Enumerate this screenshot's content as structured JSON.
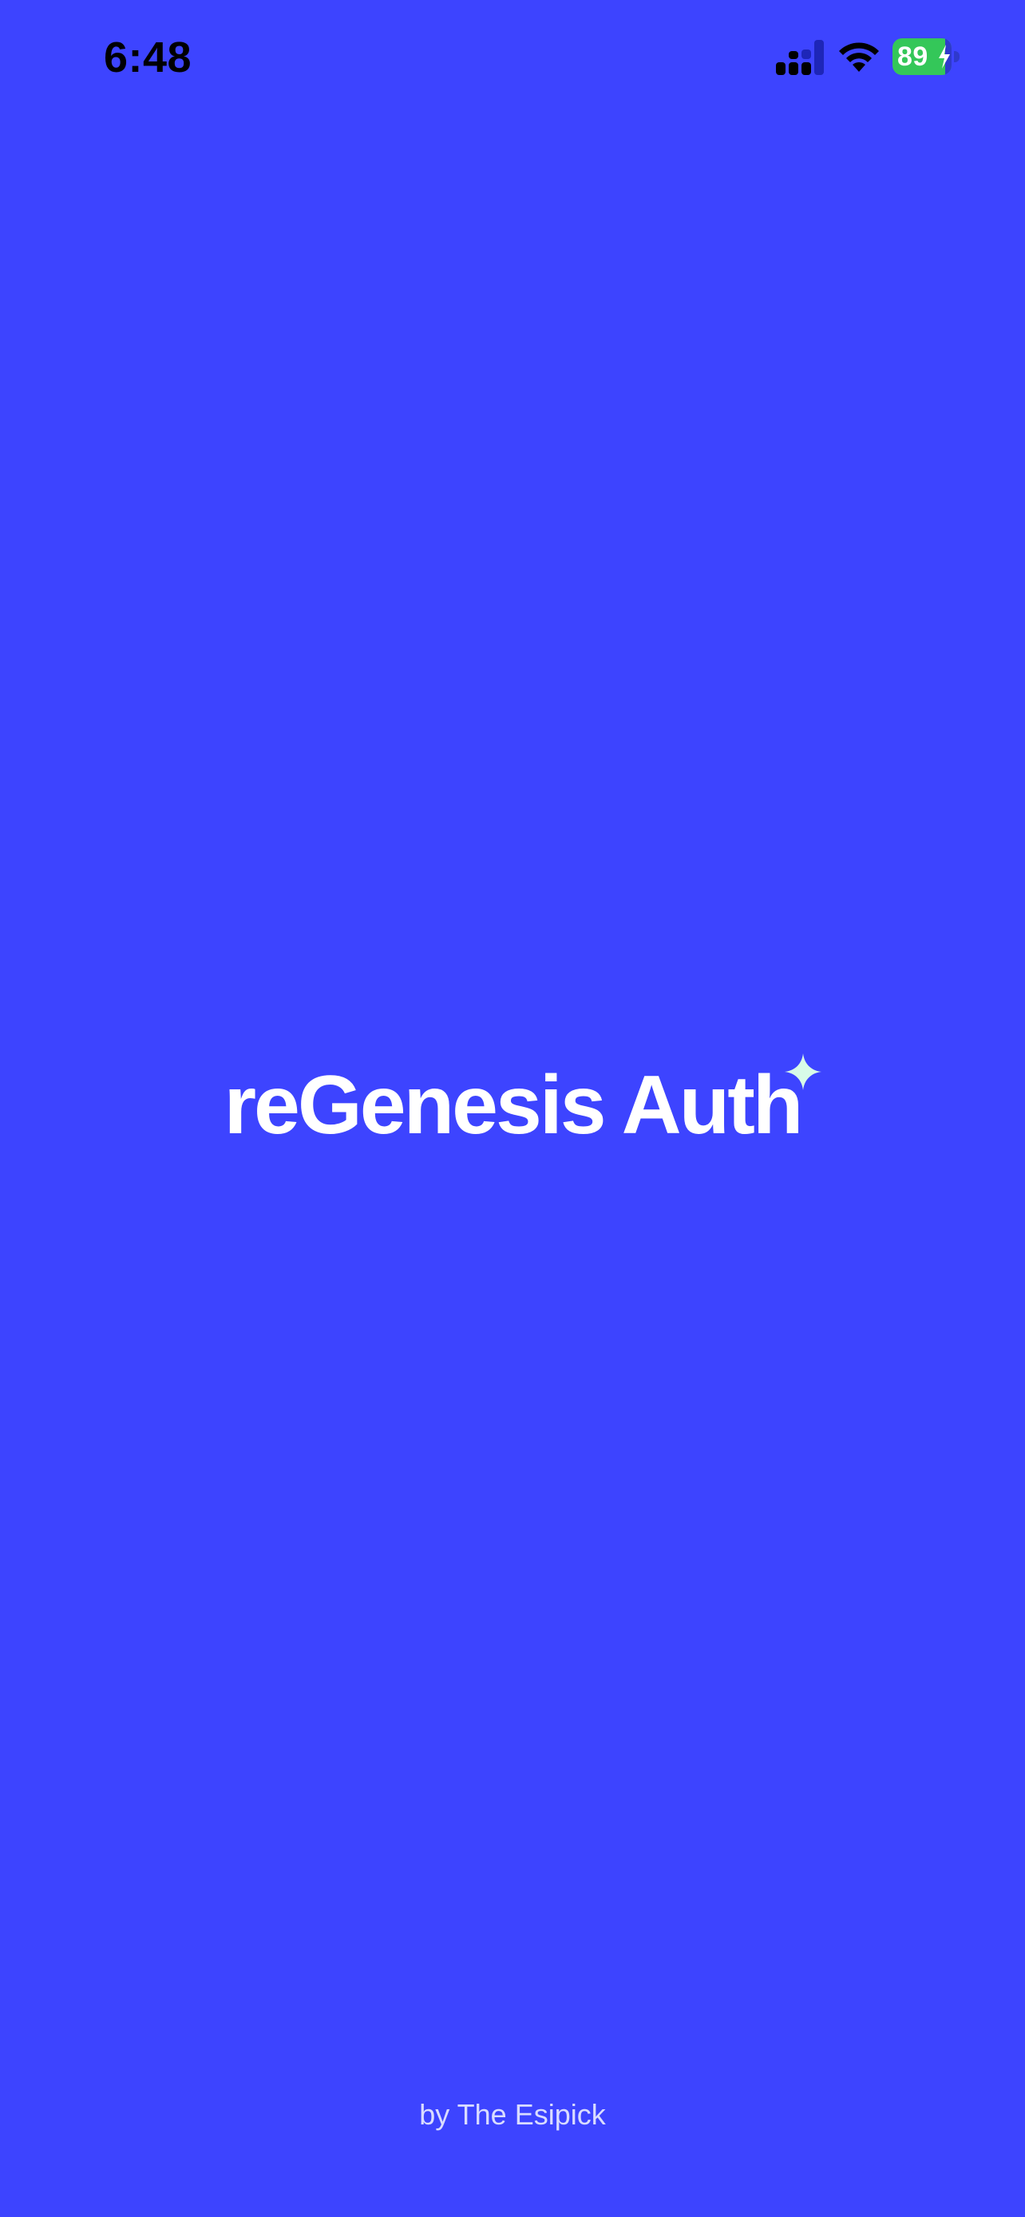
{
  "status_bar": {
    "time": "6:48",
    "battery_percent": 89,
    "battery_text": "89",
    "battery_charging": true,
    "icons": {
      "signal": "cellular-signal-icon",
      "wifi": "wifi-icon",
      "battery": "battery-icon",
      "charging": "charging-bolt-icon"
    }
  },
  "splash": {
    "title": "reGenesis Auth",
    "sparkle_icon": "sparkle-icon",
    "footer": "by The Esipick"
  },
  "colors": {
    "background": "#3d44ff",
    "title": "#ffffff",
    "sparkle": "#d8fbe8",
    "battery_fill": "#34c759",
    "status_text": "#000000"
  }
}
